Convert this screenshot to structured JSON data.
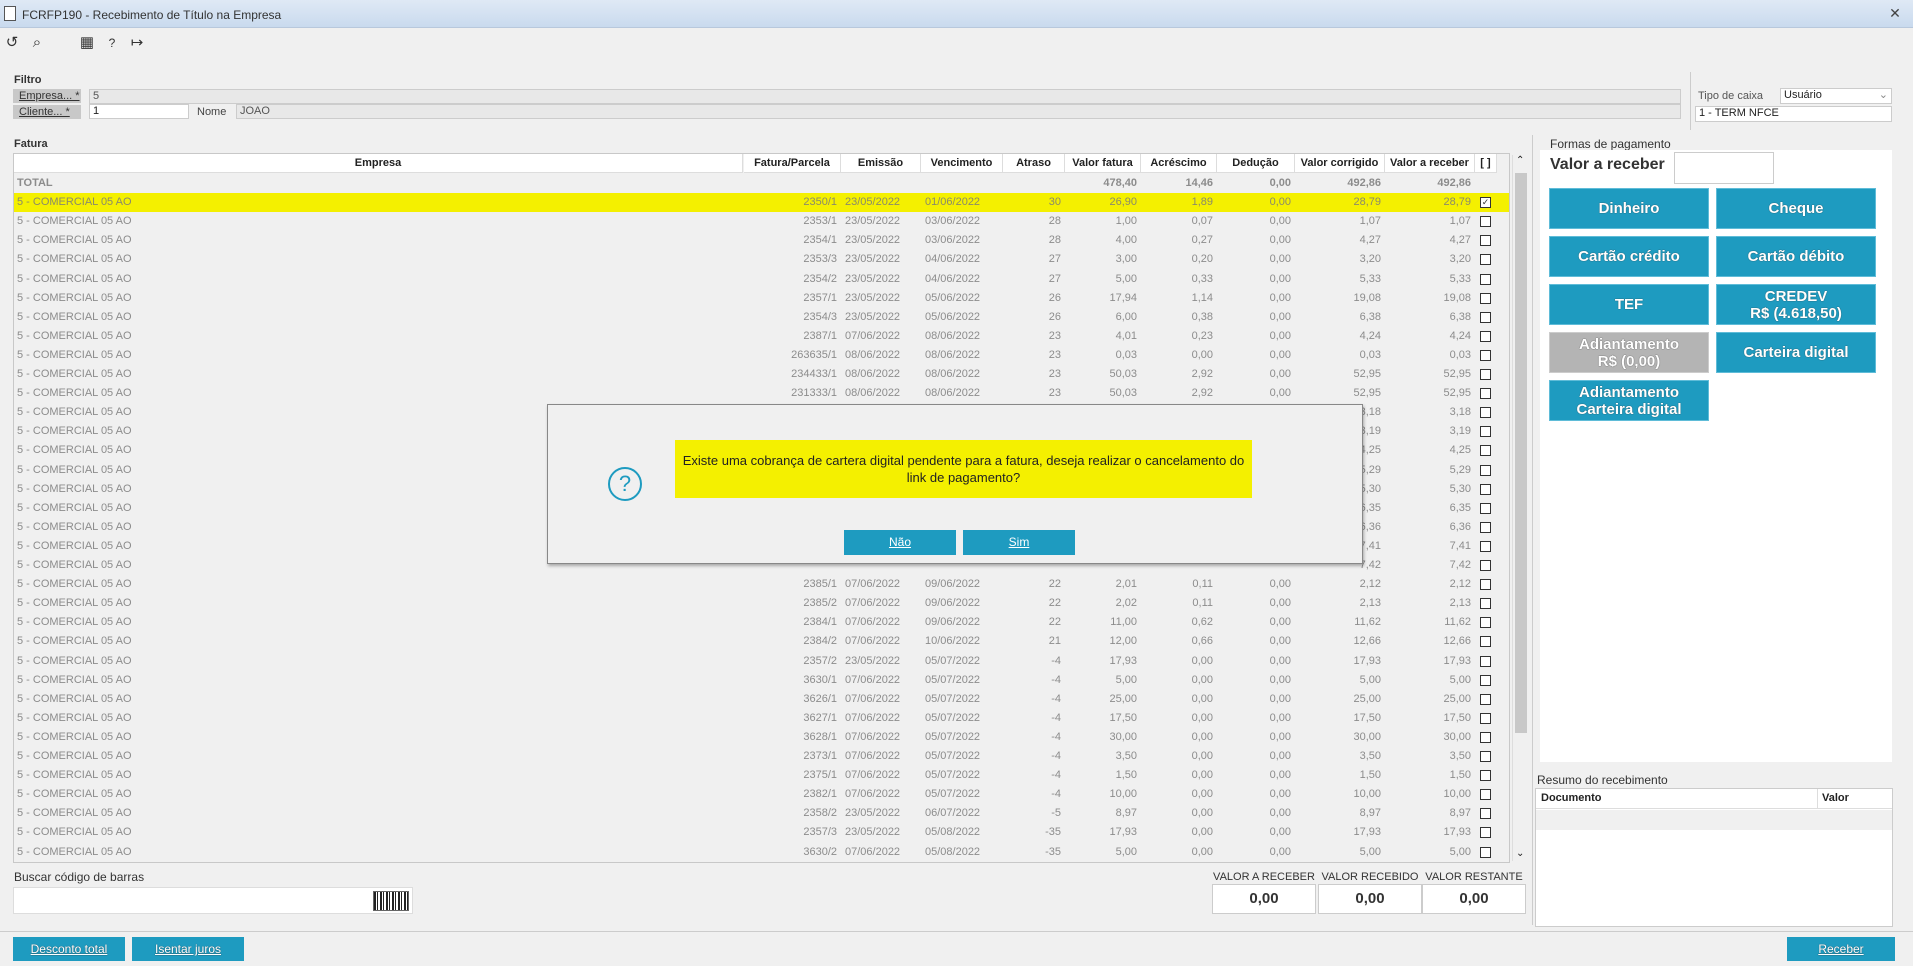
{
  "window": {
    "title": "FCRFP190 - Recebimento de Título na Empresa",
    "close": "✕"
  },
  "toolbar": {
    "icons": [
      "refresh-icon",
      "search-icon",
      "calendar-icon",
      "help-icon",
      "exit-icon"
    ],
    "glyphs": [
      "↺",
      "⌕",
      "▦",
      "?",
      "↦"
    ]
  },
  "filter": {
    "title": "Filtro",
    "empresa_label": "Empresa... *",
    "empresa_value": "5",
    "cliente_label": "Cliente... *",
    "cliente_value": "1",
    "nome_label": "Nome",
    "nome_value": "JOAO",
    "tipo_caixa_label": "Tipo de caixa",
    "tipo_caixa_value": "Usuário",
    "term_value": "1 - TERM NFCE"
  },
  "fatura": {
    "title": "Fatura",
    "columns": [
      "Empresa",
      "Fatura/Parcela",
      "Emissão",
      "Vencimento",
      "Atraso",
      "Valor fatura",
      "Acréscimo",
      "Dedução",
      "Valor corrigido",
      "Valor a receber",
      "[ ]"
    ],
    "total_row": [
      "TOTAL",
      "",
      "",
      "",
      "",
      "478,40",
      "14,46",
      "0,00",
      "492,86",
      "492,86"
    ],
    "rows": [
      [
        "5 - COMERCIAL 05 AO",
        "2350/1",
        "23/05/2022",
        "01/06/2022",
        "30",
        "26,90",
        "1,89",
        "0,00",
        "28,79",
        "28,79",
        "✓"
      ],
      [
        "5 - COMERCIAL 05 AO",
        "2353/1",
        "23/05/2022",
        "03/06/2022",
        "28",
        "1,00",
        "0,07",
        "0,00",
        "1,07",
        "1,07",
        ""
      ],
      [
        "5 - COMERCIAL 05 AO",
        "2354/1",
        "23/05/2022",
        "03/06/2022",
        "28",
        "4,00",
        "0,27",
        "0,00",
        "4,27",
        "4,27",
        ""
      ],
      [
        "5 - COMERCIAL 05 AO",
        "2353/3",
        "23/05/2022",
        "04/06/2022",
        "27",
        "3,00",
        "0,20",
        "0,00",
        "3,20",
        "3,20",
        ""
      ],
      [
        "5 - COMERCIAL 05 AO",
        "2354/2",
        "23/05/2022",
        "04/06/2022",
        "27",
        "5,00",
        "0,33",
        "0,00",
        "5,33",
        "5,33",
        ""
      ],
      [
        "5 - COMERCIAL 05 AO",
        "2357/1",
        "23/05/2022",
        "05/06/2022",
        "26",
        "17,94",
        "1,14",
        "0,00",
        "19,08",
        "19,08",
        ""
      ],
      [
        "5 - COMERCIAL 05 AO",
        "2354/3",
        "23/05/2022",
        "05/06/2022",
        "26",
        "6,00",
        "0,38",
        "0,00",
        "6,38",
        "6,38",
        ""
      ],
      [
        "5 - COMERCIAL 05 AO",
        "2387/1",
        "07/06/2022",
        "08/06/2022",
        "23",
        "4,01",
        "0,23",
        "0,00",
        "4,24",
        "4,24",
        ""
      ],
      [
        "5 - COMERCIAL 05 AO",
        "263635/1",
        "08/06/2022",
        "08/06/2022",
        "23",
        "0,03",
        "0,00",
        "0,00",
        "0,03",
        "0,03",
        ""
      ],
      [
        "5 - COMERCIAL 05 AO",
        "234433/1",
        "08/06/2022",
        "08/06/2022",
        "23",
        "50,03",
        "2,92",
        "0,00",
        "52,95",
        "52,95",
        ""
      ],
      [
        "5 - COMERCIAL 05 AO",
        "231333/1",
        "08/06/2022",
        "08/06/2022",
        "23",
        "50,03",
        "2,92",
        "0,00",
        "52,95",
        "52,95",
        ""
      ],
      [
        "5 - COMERCIAL 05 AO",
        "",
        "",
        "",
        "",
        "",
        "",
        "",
        "3,18",
        "3,18",
        ""
      ],
      [
        "5 - COMERCIAL 05 AO",
        "",
        "",
        "",
        "",
        "",
        "",
        "",
        "3,19",
        "3,19",
        ""
      ],
      [
        "5 - COMERCIAL 05 AO",
        "",
        "",
        "",
        "",
        "",
        "",
        "",
        "4,25",
        "4,25",
        ""
      ],
      [
        "5 - COMERCIAL 05 AO",
        "",
        "",
        "",
        "",
        "",
        "",
        "",
        "5,29",
        "5,29",
        ""
      ],
      [
        "5 - COMERCIAL 05 AO",
        "",
        "",
        "",
        "",
        "",
        "",
        "",
        "5,30",
        "5,30",
        ""
      ],
      [
        "5 - COMERCIAL 05 AO",
        "",
        "",
        "",
        "",
        "",
        "",
        "",
        "6,35",
        "6,35",
        ""
      ],
      [
        "5 - COMERCIAL 05 AO",
        "",
        "",
        "",
        "",
        "",
        "",
        "",
        "6,36",
        "6,36",
        ""
      ],
      [
        "5 - COMERCIAL 05 AO",
        "",
        "",
        "",
        "",
        "",
        "",
        "",
        "7,41",
        "7,41",
        ""
      ],
      [
        "5 - COMERCIAL 05 AO",
        "",
        "",
        "",
        "",
        "",
        "",
        "",
        "7,42",
        "7,42",
        ""
      ],
      [
        "5 - COMERCIAL 05 AO",
        "2385/1",
        "07/06/2022",
        "09/06/2022",
        "22",
        "2,01",
        "0,11",
        "0,00",
        "2,12",
        "2,12",
        ""
      ],
      [
        "5 - COMERCIAL 05 AO",
        "2385/2",
        "07/06/2022",
        "09/06/2022",
        "22",
        "2,02",
        "0,11",
        "0,00",
        "2,13",
        "2,13",
        ""
      ],
      [
        "5 - COMERCIAL 05 AO",
        "2384/1",
        "07/06/2022",
        "09/06/2022",
        "22",
        "11,00",
        "0,62",
        "0,00",
        "11,62",
        "11,62",
        ""
      ],
      [
        "5 - COMERCIAL 05 AO",
        "2384/2",
        "07/06/2022",
        "10/06/2022",
        "21",
        "12,00",
        "0,66",
        "0,00",
        "12,66",
        "12,66",
        ""
      ],
      [
        "5 - COMERCIAL 05 AO",
        "2357/2",
        "23/05/2022",
        "05/07/2022",
        "-4",
        "17,93",
        "0,00",
        "0,00",
        "17,93",
        "17,93",
        ""
      ],
      [
        "5 - COMERCIAL 05 AO",
        "3630/1",
        "07/06/2022",
        "05/07/2022",
        "-4",
        "5,00",
        "0,00",
        "0,00",
        "5,00",
        "5,00",
        ""
      ],
      [
        "5 - COMERCIAL 05 AO",
        "3626/1",
        "07/06/2022",
        "05/07/2022",
        "-4",
        "25,00",
        "0,00",
        "0,00",
        "25,00",
        "25,00",
        ""
      ],
      [
        "5 - COMERCIAL 05 AO",
        "3627/1",
        "07/06/2022",
        "05/07/2022",
        "-4",
        "17,50",
        "0,00",
        "0,00",
        "17,50",
        "17,50",
        ""
      ],
      [
        "5 - COMERCIAL 05 AO",
        "3628/1",
        "07/06/2022",
        "05/07/2022",
        "-4",
        "30,00",
        "0,00",
        "0,00",
        "30,00",
        "30,00",
        ""
      ],
      [
        "5 - COMERCIAL 05 AO",
        "2373/1",
        "07/06/2022",
        "05/07/2022",
        "-4",
        "3,50",
        "0,00",
        "0,00",
        "3,50",
        "3,50",
        ""
      ],
      [
        "5 - COMERCIAL 05 AO",
        "2375/1",
        "07/06/2022",
        "05/07/2022",
        "-4",
        "1,50",
        "0,00",
        "0,00",
        "1,50",
        "1,50",
        ""
      ],
      [
        "5 - COMERCIAL 05 AO",
        "2382/1",
        "07/06/2022",
        "05/07/2022",
        "-4",
        "10,00",
        "0,00",
        "0,00",
        "10,00",
        "10,00",
        ""
      ],
      [
        "5 - COMERCIAL 05 AO",
        "2358/2",
        "23/05/2022",
        "06/07/2022",
        "-5",
        "8,97",
        "0,00",
        "0,00",
        "8,97",
        "8,97",
        ""
      ],
      [
        "5 - COMERCIAL 05 AO",
        "2357/3",
        "23/05/2022",
        "05/08/2022",
        "-35",
        "17,93",
        "0,00",
        "0,00",
        "17,93",
        "17,93",
        ""
      ],
      [
        "5 - COMERCIAL 05 AO",
        "3630/2",
        "07/06/2022",
        "05/08/2022",
        "-35",
        "5,00",
        "0,00",
        "0,00",
        "5,00",
        "5,00",
        ""
      ]
    ]
  },
  "barcode": {
    "label": "Buscar código de barras"
  },
  "totals": {
    "a_receber_label": "VALOR A RECEBER",
    "a_receber": "0,00",
    "recebido_label": "VALOR RECEBIDO",
    "recebido": "0,00",
    "restante_label": "VALOR RESTANTE",
    "restante": "0,00"
  },
  "payment": {
    "title": "Formas de pagamento",
    "valor_label": "Valor a receber",
    "dinheiro": "Dinheiro",
    "cheque": "Cheque",
    "credito": "Cartão crédito",
    "debito": "Cartão débito",
    "tef": "TEF",
    "credev_1": "CREDEV",
    "credev_2": "R$ (4.618,50)",
    "adiant_1": "Adiantamento",
    "adiant_2": "R$ (0,00)",
    "carteira": "Carteira digital",
    "adiant_cart_1": "Adiantamento",
    "adiant_cart_2": "Carteira digital"
  },
  "resumo": {
    "title": "Resumo do recebimento",
    "col_documento": "Documento",
    "col_valor": "Valor"
  },
  "footer": {
    "desconto": "Desconto total",
    "isentar": "Isentar juros",
    "receber": "Receber"
  },
  "modal": {
    "message": "Existe uma cobrança de cartera digital pendente para a fatura, deseja realizar o cancelamento do link de pagamento?",
    "icon": "?",
    "nao": "Não",
    "sim": "Sim"
  },
  "colors": {
    "accent": "#1e9bc0",
    "highlight": "#f4f000",
    "disabled": "#b4b4b4"
  }
}
